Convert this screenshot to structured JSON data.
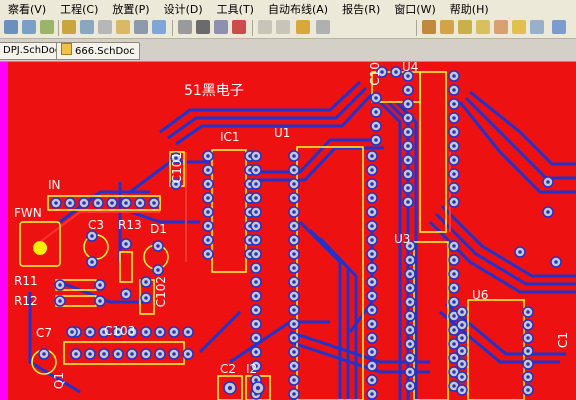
{
  "menu": [
    "察看(V)",
    "工程(C)",
    "放置(P)",
    "设计(D)",
    "工具(T)",
    "自动布线(A)",
    "报告(R)",
    "窗口(W)",
    "帮助(H)"
  ],
  "tabs": [
    "DPJ.SchDoc",
    "666.SchDoc"
  ],
  "pcb": {
    "title": "51黑电子",
    "labels": {
      "IC1": "IC1",
      "U1": "U1",
      "U3": "U3",
      "U4": "U4",
      "U6": "U6",
      "IN": "IN",
      "FWN": "FWN",
      "C3": "C3",
      "R13": "R13",
      "D1": "D1",
      "R11": "R11",
      "R12": "R12",
      "C7": "C7",
      "C103": "C103",
      "C2": "C2",
      "I2": "I2",
      "C101": "C101",
      "C102": "C102",
      "C10": "C10",
      "Q1": "Q1",
      "C1": "C1"
    }
  },
  "colors": {
    "board": "#ee1111",
    "silk": "#ffff33",
    "bottom_trace": "#2233cc",
    "pad": "#c8c8c8"
  }
}
